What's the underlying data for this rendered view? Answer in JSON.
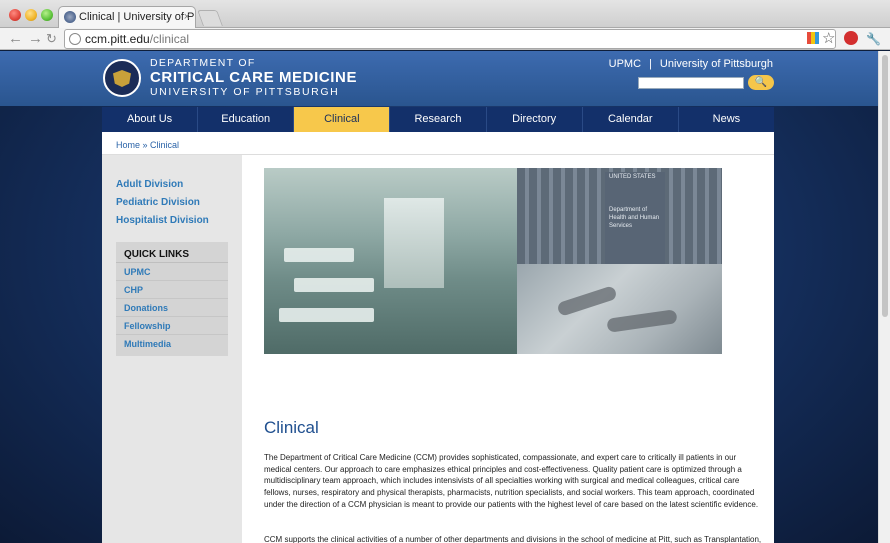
{
  "browser": {
    "tab_title": "Clinical | University of Pittsb",
    "tab_close": "×",
    "url_host": "ccm.pitt.edu",
    "url_path": "/clinical",
    "back_glyph": "←",
    "forward_glyph": "→",
    "star_glyph": "☆",
    "wrench_glyph": "🔧"
  },
  "header": {
    "logo_line1": "DEPARTMENT OF",
    "logo_line2": "CRITICAL CARE MEDICINE",
    "logo_line3": "UNIVERSITY OF PITTSBURGH",
    "links": [
      "UPMC",
      "University of Pittsburgh"
    ],
    "link_separator": "|",
    "search_placeholder": "",
    "search_icon": "🔍"
  },
  "nav": {
    "items": [
      "About Us",
      "Education",
      "Clinical",
      "Research",
      "Directory",
      "Calendar",
      "News"
    ],
    "active_index": 2
  },
  "breadcrumb": "Home » Clinical",
  "sidebar": {
    "divisions": [
      "Adult Division",
      "Pediatric Division",
      "Hospitalist Division"
    ],
    "quick_links_title": "QUICK LINKS",
    "quick_links": [
      "UPMC",
      "CHP",
      "Donations",
      "Fellowship",
      "Multimedia"
    ]
  },
  "hero": {
    "sign_line1": "UNITED STATES",
    "sign_line2": "Department of Health and Human Services"
  },
  "main": {
    "title": "Clinical",
    "paragraphs": [
      "The Department of Critical Care Medicine (CCM) provides sophisticated, compassionate, and expert care to critically ill patients in our medical centers. Our approach to care emphasizes ethical principles and cost-effectiveness. Quality patient care is optimized through a multidisciplinary team approach, which includes intensivists of all specialties working with surgical and medical colleagues, critical care fellows, nurses, respiratory and physical therapists, pharmacists, nutrition specialists, and social workers. This team approach, coordinated under the direction of a CCM physician is meant to provide our patients with the highest level of care based on the latest scientific evidence.",
      "CCM supports the clinical activities of a number of other departments and divisions in the school of medicine at Pitt, such as Transplantation, Surgery, Cardiothoracic Surgery, Trauma and General Surgery, Neurology, Neurosurgery, Pediatrics, and Obstetrics and Gynecology. Our Department’s physicians provide coverage at all UPMC hospitals in the Oakland, Pittsburgh area."
    ]
  },
  "colors": {
    "nav_active": "#f7c84b",
    "nav_bg": "#13306a",
    "link": "#2f7ab8",
    "title": "#1f4f8f"
  }
}
